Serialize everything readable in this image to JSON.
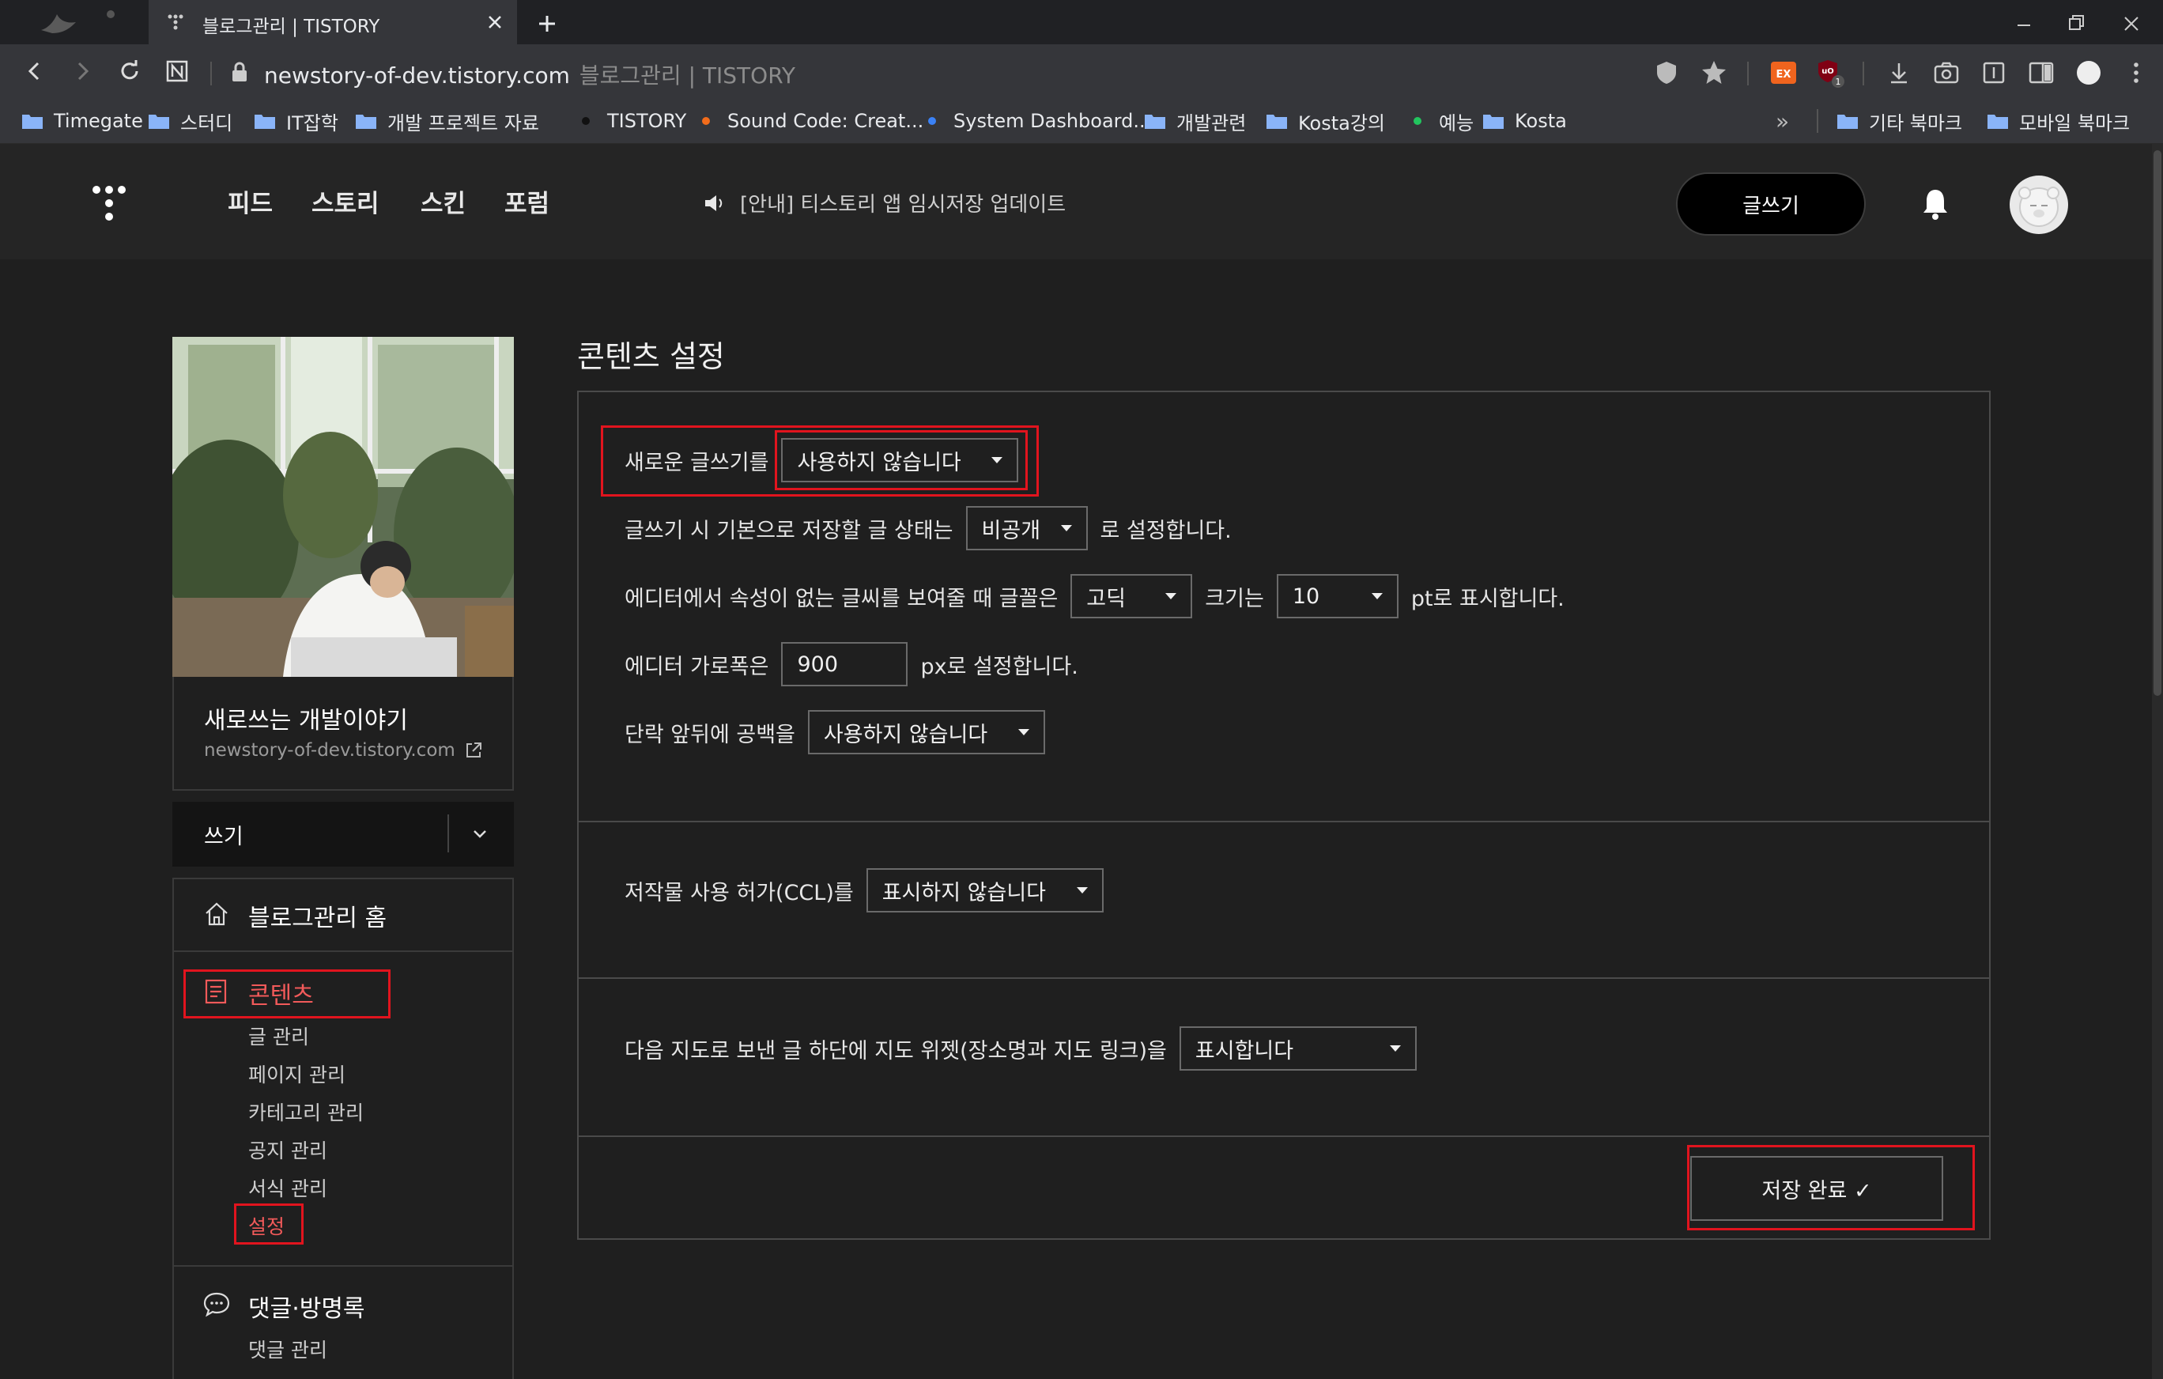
{
  "browser": {
    "tab_title": "블로그관리 | TISTORY",
    "url_host": "newstory-of-dev.tistory.com",
    "url_title": "블로그관리 | TISTORY",
    "extension_badge": "1",
    "bookmarks": [
      {
        "label": "Timegate",
        "kind": "folder"
      },
      {
        "label": "스터디",
        "kind": "folder"
      },
      {
        "label": "IT잡학",
        "kind": "folder"
      },
      {
        "label": "개발 프로젝트 자료",
        "kind": "folder"
      },
      {
        "label": "TISTORY",
        "kind": "dot",
        "color": "#111111"
      },
      {
        "label": "Sound Code: Creat...",
        "kind": "dot",
        "color": "#f26c1b"
      },
      {
        "label": "System Dashboard...",
        "kind": "dot",
        "color": "#3b82f6"
      },
      {
        "label": "개발관련",
        "kind": "folder"
      },
      {
        "label": "Kosta강의",
        "kind": "folder"
      },
      {
        "label": "예능",
        "kind": "dot",
        "color": "#22c55e"
      },
      {
        "label": "Kosta",
        "kind": "folder"
      }
    ],
    "bookmarks_overflow": "»",
    "other_bookmarks": "기타 북마크",
    "mobile_bookmarks": "모바일 북마크"
  },
  "header": {
    "nav": [
      "피드",
      "스토리",
      "스킨",
      "포럼"
    ],
    "notice": "[안내] 티스토리 앱 임시저장 업데이트",
    "write_button": "글쓰기"
  },
  "sidebar": {
    "blog_name": "새로쓰는 개발이야기",
    "blog_url": "newstory-of-dev.tistory.com",
    "write_select": "쓰기",
    "home": "블로그관리 홈",
    "contents": {
      "label": "콘텐츠",
      "items": [
        "글 관리",
        "페이지 관리",
        "카테고리 관리",
        "공지 관리",
        "서식 관리",
        "설정"
      ]
    },
    "comments": {
      "label": "댓글·방명록",
      "items": [
        "댓글 관리"
      ]
    }
  },
  "main": {
    "title": "콘텐츠 설정",
    "new_editor": {
      "label": "새로운 글쓰기를",
      "value": "사용하지 않습니다"
    },
    "default_status": {
      "prefix": "글쓰기 시 기본으로 저장할 글 상태는",
      "value": "비공개",
      "suffix": "로 설정합니다."
    },
    "font": {
      "prefix": "에디터에서 속성이 없는 글씨를 보여줄 때 글꼴은",
      "font_value": "고딕",
      "size_label": "크기는",
      "size_value": "10",
      "suffix": "pt로 표시합니다."
    },
    "editor_width": {
      "prefix": "에디터 가로폭은",
      "value": "900",
      "suffix": "px로 설정합니다."
    },
    "paragraph_space": {
      "prefix": "단락 앞뒤에 공백을",
      "value": "사용하지 않습니다"
    },
    "ccl": {
      "prefix": "저작물 사용 허가(CCL)를",
      "value": "표시하지 않습니다"
    },
    "map": {
      "prefix": "다음 지도로 보낸 글 하단에 지도 위젯(장소명과 지도 링크)을",
      "value": "표시합니다"
    },
    "save_button": "저장 완료 ✓"
  },
  "colors": {
    "highlight": "#e1141e",
    "active_menu": "#f25a5a",
    "page_bg": "#1f1f1f"
  }
}
